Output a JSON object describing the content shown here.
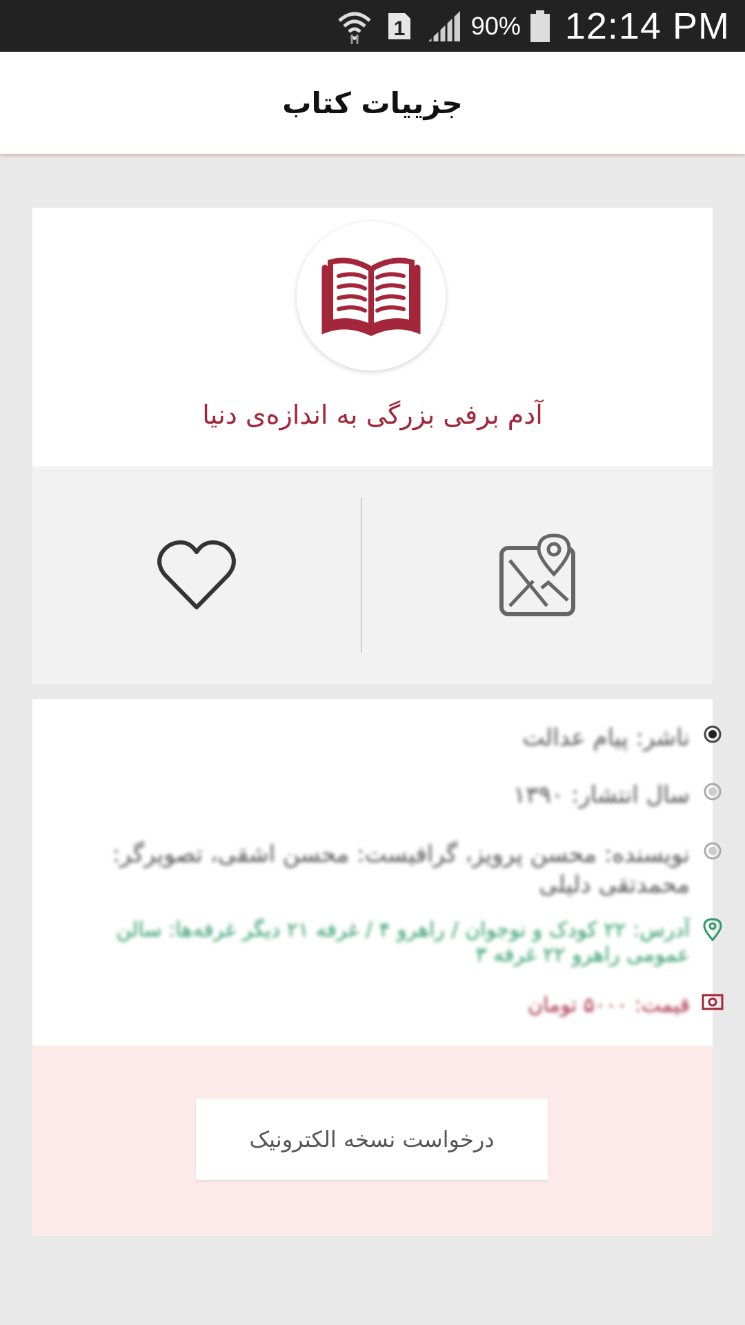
{
  "status_bar": {
    "sim_slot": "1",
    "battery_percent": "90%",
    "time": "12:14 PM",
    "icons": [
      "wifi-icon",
      "sim-icon",
      "signal-icon",
      "battery-icon"
    ]
  },
  "app_bar": {
    "title": "جزییات کتاب"
  },
  "book": {
    "icon": "open-book-icon",
    "title": "آدم برفی بزرگی به اندازه‌ی دنیا",
    "accent_color": "#a3263a"
  },
  "actions": {
    "favorite_icon": "heart-icon",
    "map_icon": "map-pin-icon"
  },
  "details": {
    "publisher": "ناشر: پیام عدالت",
    "year": "سال انتشار: ۱۳۹۰",
    "author": "نویسنده: محسن پرویز، گرافیست: محسن اشقی، تصویرگر: محمدتقی دلیلی",
    "address": "آدرس: ۲۲ کودک و نوجوان / راهرو ۴ / غرفه ۲۱ دیگر غرفه‌ها: سالن عمومی راهرو ۲۲ غرفه ۳",
    "price": "قیمت: ۵۰۰۰ تومان",
    "address_color": "#2e9a6a",
    "price_color": "#a3263a"
  },
  "request": {
    "label": "درخواست نسخه الکترونیک",
    "panel_color": "#fdebeb"
  }
}
